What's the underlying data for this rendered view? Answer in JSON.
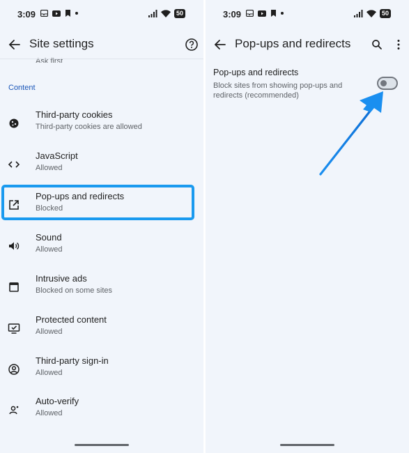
{
  "status_bar": {
    "time": "3:09",
    "battery": "50"
  },
  "left_screen": {
    "title": "Site settings",
    "clipped_item_sub": "Ask first",
    "section_label": "Content",
    "items": [
      {
        "label": "Third-party cookies",
        "sub": "Third-party cookies are allowed",
        "icon": "cookie-icon"
      },
      {
        "label": "JavaScript",
        "sub": "Allowed",
        "icon": "code-icon"
      },
      {
        "label": "Pop-ups and redirects",
        "sub": "Blocked",
        "icon": "open-in-new-icon"
      },
      {
        "label": "Sound",
        "sub": "Allowed",
        "icon": "speaker-icon"
      },
      {
        "label": "Intrusive ads",
        "sub": "Blocked on some sites",
        "icon": "ads-frame-icon"
      },
      {
        "label": "Protected content",
        "sub": "Allowed",
        "icon": "protected-content-icon"
      },
      {
        "label": "Third-party sign-in",
        "sub": "Allowed",
        "icon": "account-circle-icon"
      },
      {
        "label": "Auto-verify",
        "sub": "Allowed",
        "icon": "person-verify-icon"
      }
    ]
  },
  "right_screen": {
    "title": "Pop-ups and redirects",
    "setting_title": "Pop-ups and redirects",
    "setting_desc": "Block sites from showing pop-ups and redirects (recommended)",
    "toggle_on": false
  },
  "colors": {
    "background": "#f1f5fb",
    "accent": "#1a56b8",
    "highlight": "#1a9aef"
  }
}
